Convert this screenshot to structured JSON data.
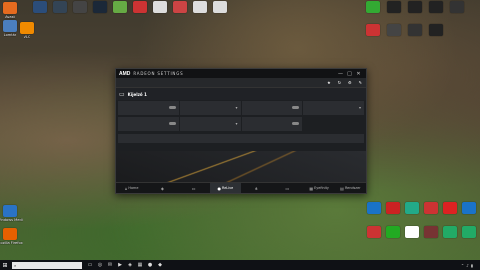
{
  "desktop": {
    "left_icons": [
      {
        "name": "recycle-bin-icon",
        "label": "Lomtár",
        "color": "#4b7fbf"
      },
      {
        "name": "avast-icon",
        "label": "Avast",
        "color": "#e56b1f"
      },
      {
        "name": "vlc-icon",
        "label": "VLC",
        "color": "#f08a00"
      },
      {
        "name": "mozilla-firefox-icon",
        "label": "Mozilla Firefox",
        "color": "#e66000"
      },
      {
        "name": "windows-media-player-icon",
        "label": "Windows Media Player",
        "color": "#2a73c5"
      },
      {
        "name": "drive-icon",
        "label": "",
        "color": "#777"
      }
    ],
    "top_icons": [
      {
        "name": "app-icon-1",
        "label": "",
        "color": "#2b4d7a"
      },
      {
        "name": "app-icon-2",
        "label": "",
        "color": "#345"
      },
      {
        "name": "app-icon-3",
        "label": "",
        "color": "#444"
      },
      {
        "name": "steam-icon",
        "label": "",
        "color": "#1b2838"
      },
      {
        "name": "app-icon-5",
        "label": "",
        "color": "#6a4"
      },
      {
        "name": "app-icon-6",
        "label": "",
        "color": "#c33"
      },
      {
        "name": "app-icon-7",
        "label": "",
        "color": "#ddd"
      },
      {
        "name": "app-icon-8",
        "label": "",
        "color": "#c44"
      },
      {
        "name": "app-icon-9",
        "label": "",
        "color": "#ddd"
      },
      {
        "name": "app-icon-10",
        "label": "",
        "color": "#ddd"
      }
    ],
    "right_icons": [
      {
        "name": "game-icon-1",
        "label": "",
        "color": "#3a3"
      },
      {
        "name": "game-icon-2",
        "label": "",
        "color": "#222"
      },
      {
        "name": "game-icon-3",
        "label": "",
        "color": "#222"
      },
      {
        "name": "game-icon-4",
        "label": "",
        "color": "#222"
      },
      {
        "name": "game-icon-5",
        "label": "",
        "color": "#333"
      },
      {
        "name": "game-icon-6",
        "label": "",
        "color": "#c33"
      },
      {
        "name": "game-icon-7",
        "label": "",
        "color": "#444"
      },
      {
        "name": "game-icon-8",
        "label": "",
        "color": "#333"
      },
      {
        "name": "game-icon-9",
        "label": "",
        "color": "#222"
      }
    ],
    "bottom_right_icons": [
      {
        "name": "app-icon-a",
        "color": "#1a73c8"
      },
      {
        "name": "app-icon-b",
        "color": "#c22"
      },
      {
        "name": "app-icon-c",
        "color": "#2a8"
      },
      {
        "name": "app-icon-d",
        "color": "#c33"
      },
      {
        "name": "app-icon-e",
        "color": "#d22"
      },
      {
        "name": "app-icon-f",
        "color": "#1a73c8"
      },
      {
        "name": "app-icon-g",
        "color": "#c33"
      },
      {
        "name": "app-icon-h",
        "color": "#2a2"
      },
      {
        "name": "app-icon-i",
        "color": "#fff"
      },
      {
        "name": "app-icon-j",
        "color": "#733"
      },
      {
        "name": "app-icon-k",
        "color": "#2a6"
      },
      {
        "name": "app-icon-l",
        "color": "#2a6"
      }
    ]
  },
  "amd": {
    "logo": "AMD",
    "title": "RADEON SETTINGS",
    "toolbar": {
      "announcement": "",
      "items": [
        "",
        "",
        " ",
        ""
      ],
      "window_buttons": [
        "—",
        "□",
        "✕"
      ]
    },
    "display": {
      "name": "Kijelző 1",
      "info": "",
      "btn1": "",
      "btn2": ""
    },
    "grid1": [
      {
        "key": "",
        "value": ""
      },
      {
        "key": "",
        "value": ""
      },
      {
        "key": "",
        "value": ""
      },
      {
        "key": "",
        "value": ""
      }
    ],
    "grid2": [
      {
        "key": "",
        "value": ""
      },
      {
        "key": "",
        "value": ""
      },
      {
        "key": "",
        "value": ""
      }
    ],
    "advanced": {
      "label": "",
      "value": ""
    },
    "nav": [
      {
        "name": "nav-home",
        "icon": "⌂",
        "label": "Home"
      },
      {
        "name": "nav-jatek",
        "icon": "◈",
        "label": ""
      },
      {
        "name": "nav-video",
        "icon": "▭",
        "label": ""
      },
      {
        "name": "nav-relive",
        "icon": "●",
        "label": "ReLive"
      },
      {
        "name": "nav-share",
        "icon": "⋔",
        "label": ""
      },
      {
        "name": "nav-display",
        "icon": "▭",
        "label": ""
      },
      {
        "name": "nav-eyefinity",
        "icon": "▦",
        "label": "Eyefinity"
      },
      {
        "name": "nav-system",
        "icon": "▤",
        "label": "Rendszer"
      }
    ]
  },
  "taskbar": {
    "start_icon": "⊞",
    "search_icon": "⌕",
    "apps": [
      "▭",
      "◎",
      "✉",
      "▶",
      "◈",
      "▦",
      "●",
      "◆"
    ],
    "tray": [
      "⌃",
      "♪",
      "▮"
    ],
    "time": "",
    "date": ""
  }
}
